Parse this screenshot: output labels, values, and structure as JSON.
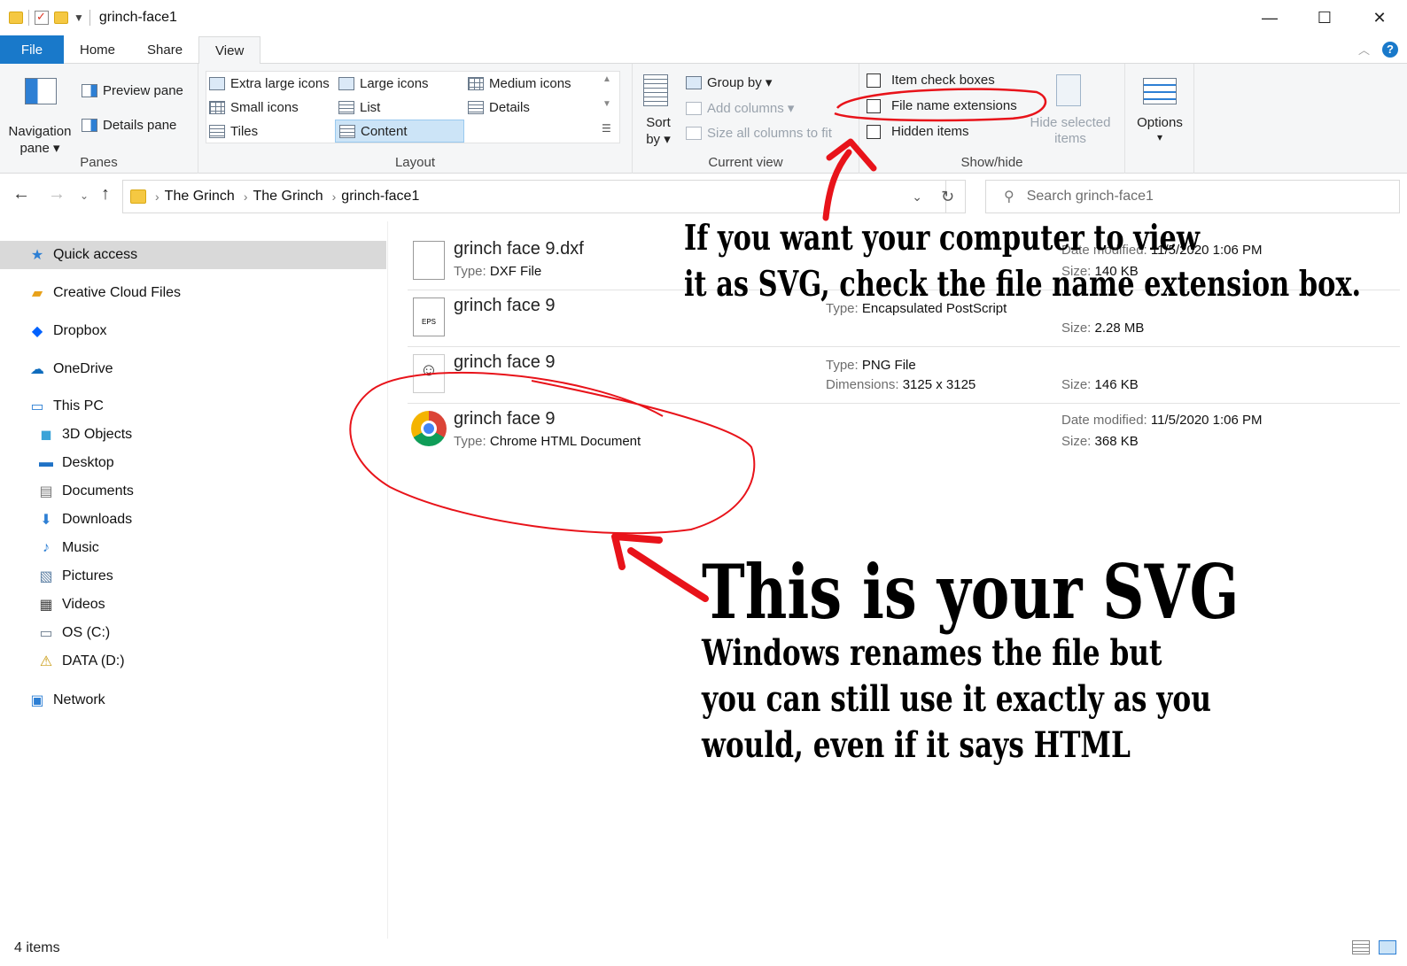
{
  "window": {
    "title": "grinch-face1",
    "minimize": "—",
    "maximize": "☐",
    "close": "✕"
  },
  "tabs": [
    "File",
    "Home",
    "Share",
    "View"
  ],
  "ribbon": {
    "panes": {
      "navigation_pane_line1": "Navigation",
      "navigation_pane_line2": "pane ▾",
      "preview_pane": "Preview pane",
      "details_pane": "Details pane",
      "label": "Panes"
    },
    "layout": {
      "extra_large_icons": "Extra large icons",
      "large_icons": "Large icons",
      "medium_icons": "Medium icons",
      "small_icons": "Small icons",
      "list": "List",
      "details": "Details",
      "tiles": "Tiles",
      "content": "Content",
      "label": "Layout"
    },
    "current_view": {
      "sort_line1": "Sort",
      "sort_line2": "by ▾",
      "group_by": "Group by ▾",
      "add_columns": "Add columns ▾",
      "size_all_columns": "Size all columns to fit",
      "label": "Current view"
    },
    "show_hide": {
      "item_check_boxes": "Item check boxes",
      "file_name_extensions": "File name extensions",
      "hidden_items": "Hidden items",
      "hide_selected_line1": "Hide selected",
      "hide_selected_line2": "items",
      "label": "Show/hide"
    },
    "options": {
      "label": "Options",
      "arrow": "▾"
    }
  },
  "address": {
    "crumbs": [
      "The Grinch",
      "The Grinch",
      "grinch-face1"
    ],
    "search_placeholder": "Search grinch-face1"
  },
  "nav": {
    "items": [
      {
        "label": "Quick access",
        "icon": "star-icon"
      },
      {
        "label": "Creative Cloud Files",
        "icon": "creative-cloud-icon"
      },
      {
        "label": "Dropbox",
        "icon": "dropbox-icon"
      },
      {
        "label": "OneDrive",
        "icon": "onedrive-icon"
      },
      {
        "label": "This PC",
        "icon": "monitor-icon"
      },
      {
        "label": "3D Objects",
        "icon": "cube-icon"
      },
      {
        "label": "Desktop",
        "icon": "desktop-icon"
      },
      {
        "label": "Documents",
        "icon": "documents-icon"
      },
      {
        "label": "Downloads",
        "icon": "download-arrow-icon"
      },
      {
        "label": "Music",
        "icon": "music-note-icon"
      },
      {
        "label": "Pictures",
        "icon": "pictures-icon"
      },
      {
        "label": "Videos",
        "icon": "film-icon"
      },
      {
        "label": "OS (C:)",
        "icon": "drive-c-icon"
      },
      {
        "label": "DATA (D:)",
        "icon": "drive-d-icon"
      },
      {
        "label": "Network",
        "icon": "network-icon"
      }
    ]
  },
  "files": [
    {
      "name": "grinch face 9.dxf",
      "type_key": "Type:",
      "type": "DXF File",
      "date_key": "Date modified:",
      "date": "11/5/2020 1:06 PM",
      "size_key": "Size:",
      "size": "140 KB"
    },
    {
      "name": "grinch face 9",
      "type_key": "Type:",
      "type": "Encapsulated PostScript",
      "size_key": "Size:",
      "size": "2.28 MB"
    },
    {
      "name": "grinch face 9",
      "type_key": "Type:",
      "type": "PNG File",
      "dim_key": "Dimensions:",
      "dim": "3125 x 3125",
      "size_key": "Size:",
      "size": "146 KB"
    },
    {
      "name": "grinch face 9",
      "type_key": "Type:",
      "type": "Chrome HTML Document",
      "date_key": "Date modified:",
      "date": "11/5/2020 1:06 PM",
      "size_key": "Size:",
      "size": "368 KB"
    }
  ],
  "status": {
    "item_count": "4 items"
  },
  "annotations": {
    "tip_line1": "If you want your computer to view",
    "tip_line2": "it as SVG, check the file name extension box.",
    "headline": "This is your SVG",
    "body_line1": "Windows renames the file but",
    "body_line2": "you can still use it exactly as you",
    "body_line3": "would, even if it says HTML"
  },
  "colors": {
    "accent": "#1979ca",
    "annotation_red": "#e8131a",
    "ribbon_bg": "#f5f6f7"
  }
}
